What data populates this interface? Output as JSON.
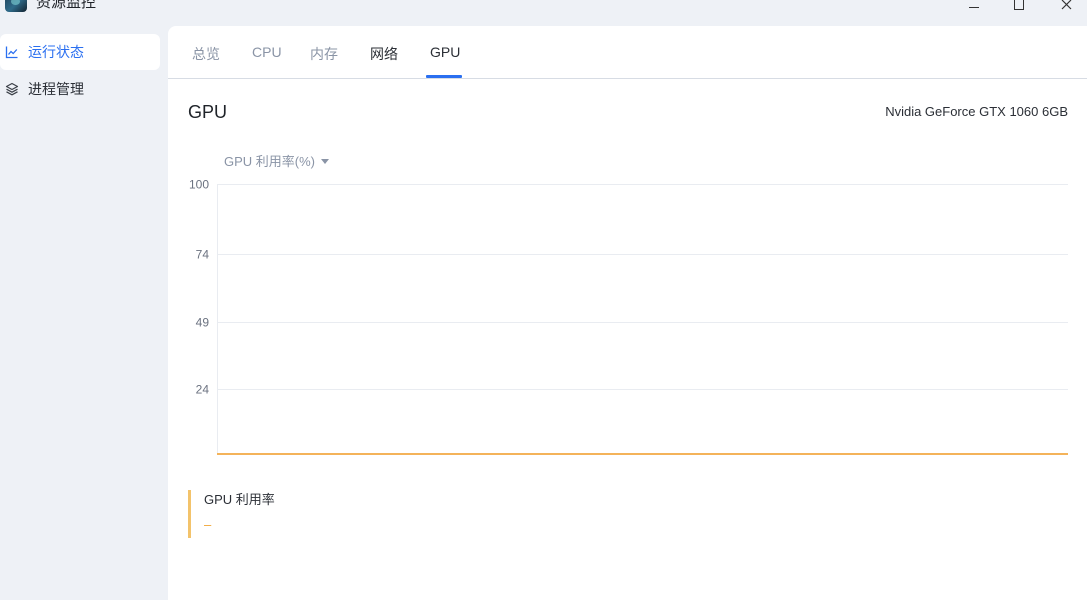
{
  "window": {
    "title": "资源监控",
    "icon": "resource-monitor-app-icon"
  },
  "sidebar": {
    "items": [
      {
        "label": "运行状态",
        "icon": "line-chart-icon",
        "active": true
      },
      {
        "label": "进程管理",
        "icon": "layers-icon",
        "active": false
      }
    ]
  },
  "tabs": [
    {
      "label": "总览"
    },
    {
      "label": "CPU"
    },
    {
      "label": "内存"
    },
    {
      "label": "网络"
    },
    {
      "label": "GPU",
      "active": true
    }
  ],
  "gpu": {
    "title": "GPU",
    "device": "Nvidia GeForce GTX 1060 6GB",
    "metric_selector": "GPU 利用率(%)",
    "legend": {
      "label": "GPU 利用率",
      "value": "–"
    }
  },
  "colors": {
    "accent": "#2a6ff0",
    "series": "#f4b35a",
    "grid": "#e9ecf1"
  },
  "chart_data": {
    "type": "line",
    "title": "",
    "xlabel": "",
    "ylabel": "",
    "ylim": [
      0,
      100
    ],
    "yticks": [
      100,
      74,
      49,
      24
    ],
    "grid": true,
    "series": [
      {
        "name": "GPU 利用率",
        "values": [
          0,
          0
        ]
      }
    ]
  }
}
